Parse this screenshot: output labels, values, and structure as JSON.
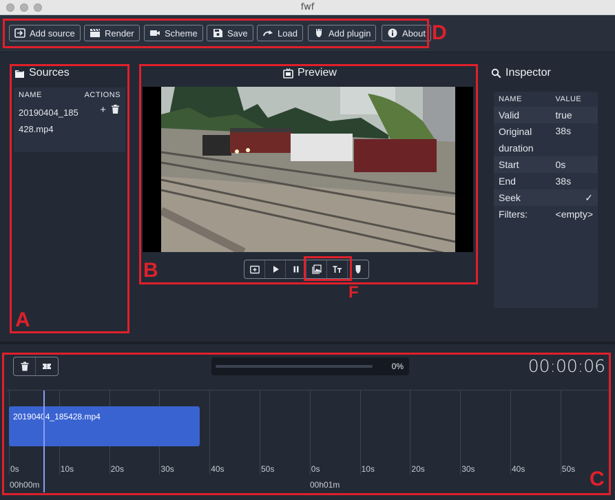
{
  "window": {
    "title": "fwf"
  },
  "toolbar": {
    "buttons": [
      {
        "label": "Add source",
        "icon": "add-source-icon"
      },
      {
        "label": "Render",
        "icon": "clapperboard-icon"
      },
      {
        "label": "Scheme",
        "icon": "video-camera-icon"
      },
      {
        "label": "Save",
        "icon": "floppy-disk-icon"
      },
      {
        "label": "Load",
        "icon": "redo-arrow-icon"
      },
      {
        "label": "Add plugin",
        "icon": "plugin-icon"
      },
      {
        "label": "About",
        "icon": "info-icon"
      }
    ]
  },
  "sources": {
    "title": "Sources",
    "col_name": "NAME",
    "col_actions": "ACTIONS",
    "items": [
      {
        "name": "20190404_185428.mp4"
      }
    ],
    "add_symbol": "+",
    "delete_icon": "trash-icon"
  },
  "preview": {
    "title": "Preview",
    "controls": [
      "add-to-timeline-icon",
      "play-icon",
      "pause-icon",
      "image-overlay-icon",
      "text-overlay-icon",
      "plugin-icon"
    ]
  },
  "inspector": {
    "title": "Inspector",
    "col_name": "NAME",
    "col_value": "VALUE",
    "rows": [
      {
        "name": "Valid",
        "value": "true"
      },
      {
        "name": "Original duration",
        "value": "38s"
      },
      {
        "name": "Start",
        "value": "0s"
      },
      {
        "name": "End",
        "value": "38s"
      },
      {
        "name": "Seek",
        "value": "✓"
      },
      {
        "name": "Filters:",
        "value": "<empty>"
      }
    ]
  },
  "timeline": {
    "progress_text": "0%",
    "progress_value": 0,
    "timecode": "00:00:06",
    "tick_labels": [
      "0s",
      "10s",
      "20s",
      "30s",
      "40s",
      "50s",
      "0s",
      "10s",
      "20s",
      "30s",
      "40s",
      "50s"
    ],
    "minute_labels": [
      "00h00m",
      "00h01m"
    ],
    "clip": {
      "label": "20190404_185428.mp4"
    }
  },
  "annotations": {
    "labels": [
      "A",
      "B",
      "C",
      "D",
      "F"
    ],
    "color": "#e0202b"
  },
  "colors": {
    "background": "#232a35",
    "panel": "#2a3140",
    "clip": "#3a63d2",
    "playhead": "#8a9df0"
  }
}
